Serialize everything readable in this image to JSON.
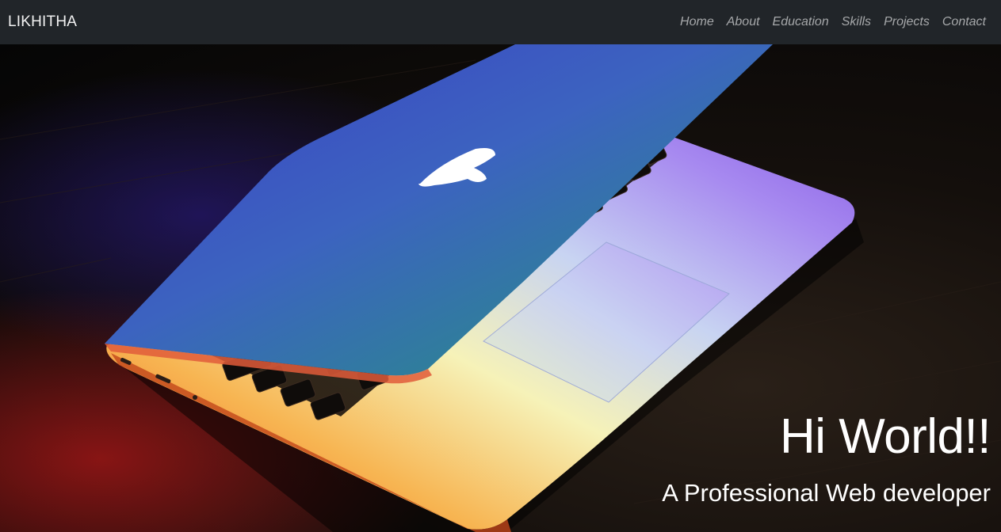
{
  "navbar": {
    "brand": "LIKHITHA",
    "links": [
      {
        "label": "Home"
      },
      {
        "label": "About"
      },
      {
        "label": "Education"
      },
      {
        "label": "Skills"
      },
      {
        "label": "Projects"
      },
      {
        "label": "Contact"
      }
    ],
    "background_color": "#212529"
  },
  "hero": {
    "title": "Hi World!!",
    "subtitle": "A Professional Web developer",
    "background_image": "laptop-illustration"
  }
}
